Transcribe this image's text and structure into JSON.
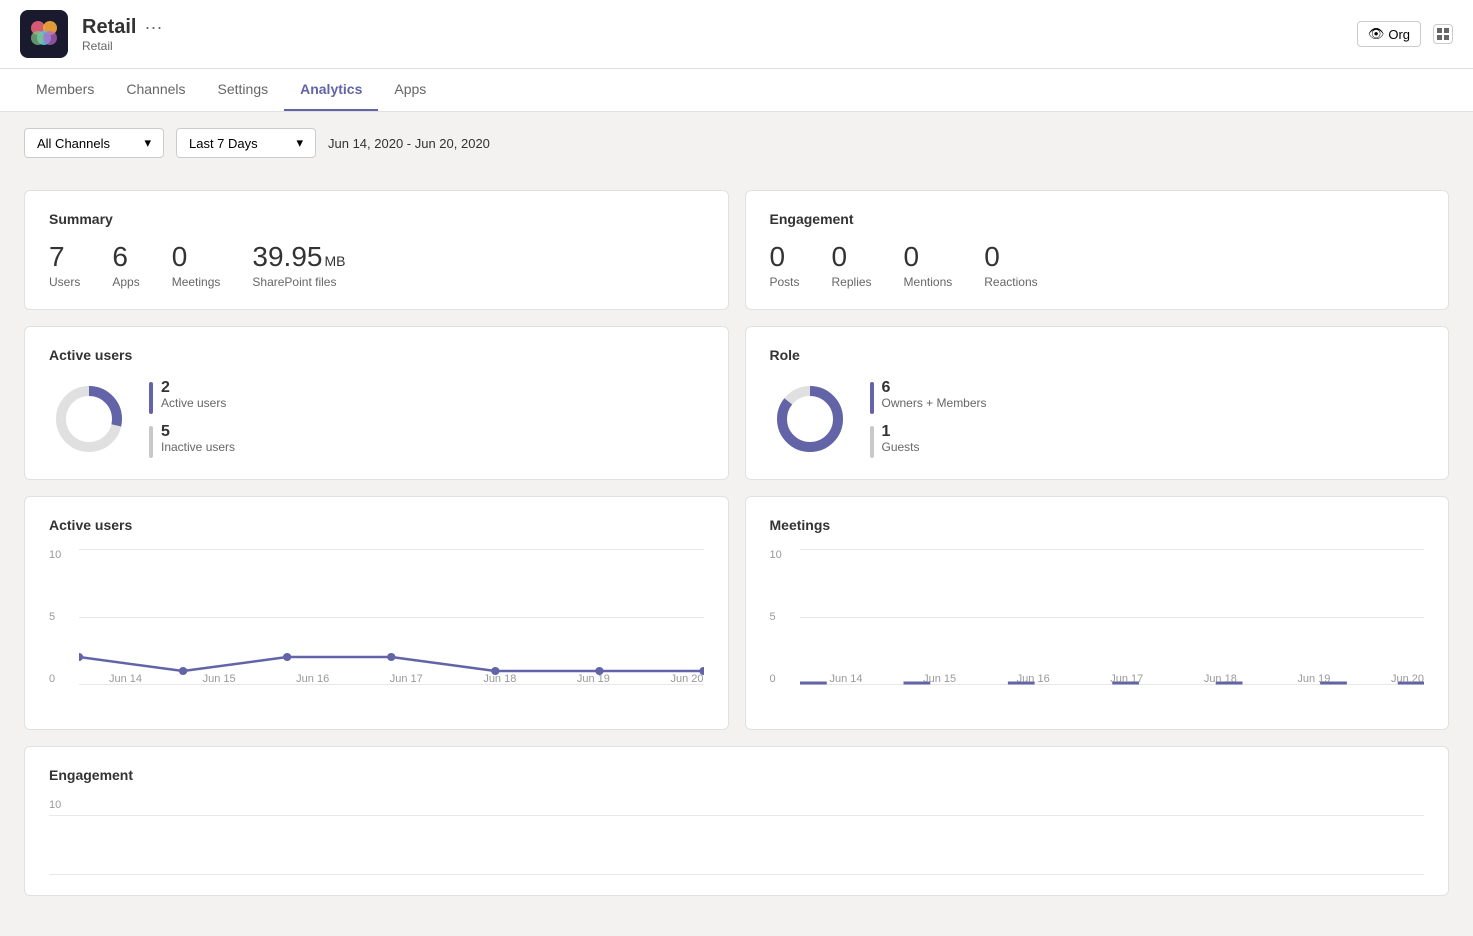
{
  "header": {
    "logo_alt": "Retail team logo",
    "title": "Retail",
    "dots": "···",
    "subtitle": "Retail",
    "org_label": "Org"
  },
  "nav": {
    "tabs": [
      {
        "id": "members",
        "label": "Members"
      },
      {
        "id": "channels",
        "label": "Channels"
      },
      {
        "id": "settings",
        "label": "Settings"
      },
      {
        "id": "analytics",
        "label": "Analytics",
        "active": true
      },
      {
        "id": "apps",
        "label": "Apps"
      }
    ]
  },
  "filters": {
    "channel_label": "All Channels",
    "period_label": "Last 7 Days",
    "date_range": "Jun 14, 2020 - Jun 20, 2020"
  },
  "summary": {
    "title": "Summary",
    "stats": [
      {
        "value": "7",
        "label": "Users"
      },
      {
        "value": "6",
        "label": "Apps"
      },
      {
        "value": "0",
        "label": "Meetings"
      },
      {
        "value": "39.95",
        "unit": "MB",
        "label": "SharePoint files"
      }
    ]
  },
  "engagement_summary": {
    "title": "Engagement",
    "stats": [
      {
        "value": "0",
        "label": "Posts"
      },
      {
        "value": "0",
        "label": "Replies"
      },
      {
        "value": "0",
        "label": "Mentions"
      },
      {
        "value": "0",
        "label": "Reactions"
      }
    ]
  },
  "active_users_donut": {
    "title": "Active users",
    "active_count": "2",
    "active_label": "Active users",
    "inactive_count": "5",
    "inactive_label": "Inactive users",
    "active_color": "#6264a7",
    "inactive_color": "#c8c8c8"
  },
  "role_donut": {
    "title": "Role",
    "owners_count": "6",
    "owners_label": "Owners + Members",
    "guests_count": "1",
    "guests_label": "Guests",
    "owners_color": "#6264a7",
    "guests_color": "#c8c8c8"
  },
  "active_users_chart": {
    "title": "Active users",
    "y_max": "10",
    "y_mid": "5",
    "y_min": "0",
    "x_labels": [
      "Jun 14",
      "Jun 15",
      "Jun 16",
      "Jun 17",
      "Jun 18",
      "Jun 19",
      "Jun 20"
    ],
    "data_points": [
      2,
      1,
      2,
      2,
      1,
      1,
      1
    ]
  },
  "meetings_chart": {
    "title": "Meetings",
    "y_max": "10",
    "y_mid": "5",
    "y_min": "0",
    "x_labels": [
      "Jun 14",
      "Jun 15",
      "Jun 16",
      "Jun 17",
      "Jun 18",
      "Jun 19",
      "Jun 20"
    ],
    "data_points": [
      0,
      0,
      0,
      0,
      0,
      0,
      0
    ]
  },
  "engagement_chart": {
    "title": "Engagement",
    "y_max": "10"
  }
}
